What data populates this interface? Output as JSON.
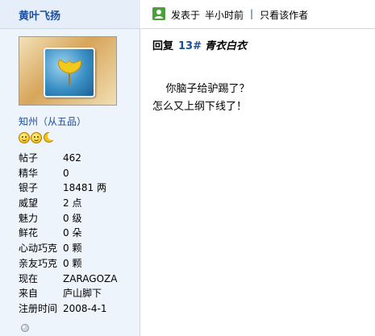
{
  "sidebar": {
    "username": "黄叶飞扬",
    "rank": "知州（从五品）",
    "stats": [
      {
        "label": "帖子",
        "value": "462"
      },
      {
        "label": "精华",
        "value": "0"
      },
      {
        "label": "银子",
        "value": "18481 两"
      },
      {
        "label": "威望",
        "value": "2 点"
      },
      {
        "label": "魅力",
        "value": "0 级"
      },
      {
        "label": "鲜花",
        "value": "0 朵"
      },
      {
        "label": "心动巧克",
        "value": "0 颗"
      },
      {
        "label": "亲友巧克",
        "value": "0 颗"
      },
      {
        "label": "现在",
        "value": "ZARAGOZA"
      },
      {
        "label": "来自",
        "value": "庐山脚下"
      },
      {
        "label": "注册时间",
        "value": "2008-4-1"
      }
    ]
  },
  "post": {
    "posted_label": "发表于",
    "posted_time": "半小时前",
    "separator": "|",
    "author_only_link": "只看该作者",
    "reply_label": "回复",
    "reply_floor": "13#",
    "reply_to": "青衣白衣",
    "body": "    你脑子给驴踢了？\n怎么又上纲下线了！"
  },
  "colors": {
    "sidebar_bg": "#eef4fc",
    "link_blue": "#1d4f9c"
  }
}
